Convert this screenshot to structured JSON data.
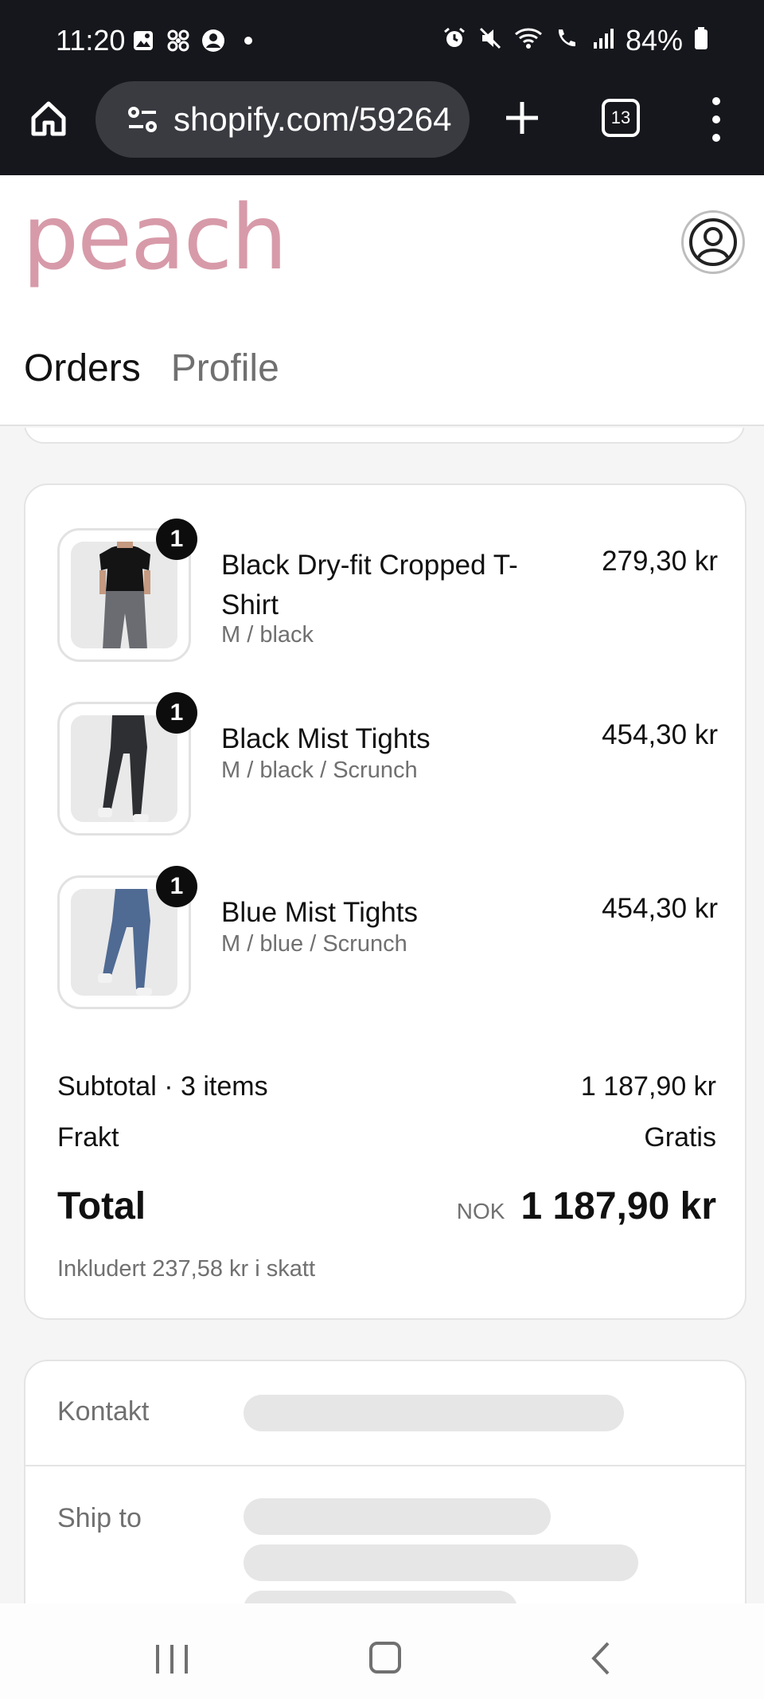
{
  "status_bar": {
    "time": "11:20",
    "battery": "84%"
  },
  "browser": {
    "url": "shopify.com/59264",
    "tab_count": "13"
  },
  "header": {
    "logo": "peach",
    "brand_color": "#d79aa9",
    "nav": [
      "Orders",
      "Profile"
    ]
  },
  "order": {
    "items": [
      {
        "qty": "1",
        "name": "Black Dry-fit Cropped T-Shirt",
        "variant": "M / black",
        "price": "279,30 kr"
      },
      {
        "qty": "1",
        "name": "Black Mist Tights",
        "variant": "M / black / Scrunch",
        "price": "454,30 kr"
      },
      {
        "qty": "1",
        "name": "Blue Mist Tights",
        "variant": "M / blue / Scrunch",
        "price": "454,30 kr"
      }
    ],
    "subtotal_label": "Subtotal · 3 items",
    "subtotal_value": "1 187,90 kr",
    "shipping_label": "Frakt",
    "shipping_value": "Gratis",
    "total_label": "Total",
    "currency": "NOK",
    "total_value": "1 187,90 kr",
    "tax_note": "Inkludert 237,58 kr i skatt"
  },
  "info": {
    "contact_label": "Kontakt",
    "ship_to_label": "Ship to"
  }
}
